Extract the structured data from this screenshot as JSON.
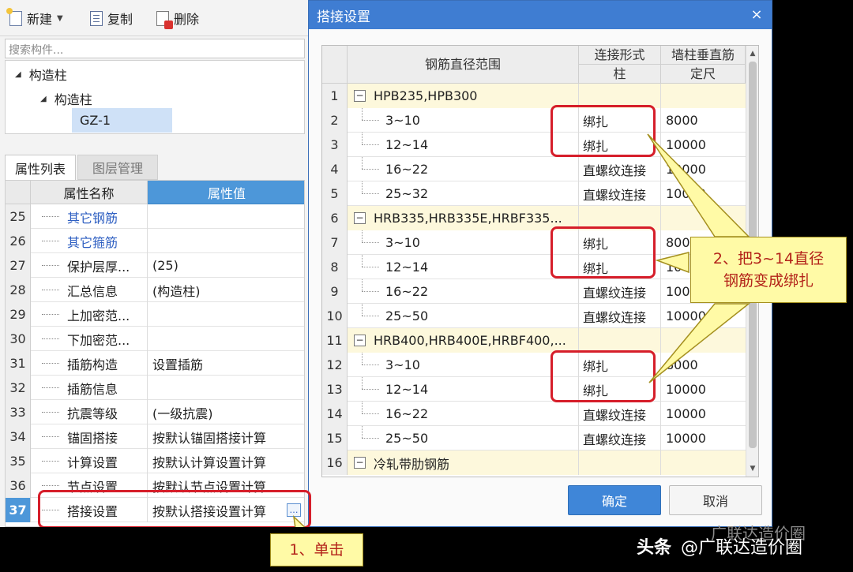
{
  "toolbar": {
    "new": "新建",
    "copy": "复制",
    "delete": "删除",
    "search_placeholder": "搜索构件..."
  },
  "tree": {
    "root": "构造柱",
    "child": "构造柱",
    "leaf": "GZ-1"
  },
  "tabs": {
    "props": "属性列表",
    "layers": "图层管理"
  },
  "props": {
    "col_name": "属性名称",
    "col_value": "属性值",
    "rows": [
      {
        "n": "25",
        "name": "其它钢筋",
        "value": ""
      },
      {
        "n": "26",
        "name": "其它箍筋",
        "value": ""
      },
      {
        "n": "27",
        "name": "保护层厚...",
        "value": "(25)"
      },
      {
        "n": "28",
        "name": "汇总信息",
        "value": "(构造柱)"
      },
      {
        "n": "29",
        "name": "上加密范...",
        "value": ""
      },
      {
        "n": "30",
        "name": "下加密范...",
        "value": ""
      },
      {
        "n": "31",
        "name": "插筋构造",
        "value": "设置插筋"
      },
      {
        "n": "32",
        "name": "插筋信息",
        "value": ""
      },
      {
        "n": "33",
        "name": "抗震等级",
        "value": "(一级抗震)"
      },
      {
        "n": "34",
        "name": "锚固搭接",
        "value": "按默认锚固搭接计算"
      },
      {
        "n": "35",
        "name": "计算设置",
        "value": "按默认计算设置计算"
      },
      {
        "n": "36",
        "name": "节点设置",
        "value": "按默认节点设置计算"
      },
      {
        "n": "37",
        "name": "搭接设置",
        "value": "按默认搭接设置计算"
      }
    ],
    "ellipsis": "…"
  },
  "dialog": {
    "title": "搭接设置",
    "close": "×",
    "col_range": "钢筋直径范围",
    "col_conn_top": "连接形式",
    "col_conn_sub": "柱",
    "col_len_top": "墙柱垂直筋",
    "col_len_sub": "定尺",
    "rows": [
      {
        "n": "1",
        "range": "HPB235,HPB300",
        "conn": "",
        "len": "",
        "group": true
      },
      {
        "n": "2",
        "range": "3~10",
        "conn": "绑扎",
        "len": "8000"
      },
      {
        "n": "3",
        "range": "12~14",
        "conn": "绑扎",
        "len": "10000"
      },
      {
        "n": "4",
        "range": "16~22",
        "conn": "直螺纹连接",
        "len": "10000"
      },
      {
        "n": "5",
        "range": "25~32",
        "conn": "直螺纹连接",
        "len": "10000"
      },
      {
        "n": "6",
        "range": "HRB335,HRB335E,HRBF335...",
        "conn": "",
        "len": "",
        "group": true
      },
      {
        "n": "7",
        "range": "3~10",
        "conn": "绑扎",
        "len": "8000"
      },
      {
        "n": "8",
        "range": "12~14",
        "conn": "绑扎",
        "len": "10000"
      },
      {
        "n": "9",
        "range": "16~22",
        "conn": "直螺纹连接",
        "len": "10000"
      },
      {
        "n": "10",
        "range": "25~50",
        "conn": "直螺纹连接",
        "len": "10000"
      },
      {
        "n": "11",
        "range": "HRB400,HRB400E,HRBF400,...",
        "conn": "",
        "len": "",
        "group": true
      },
      {
        "n": "12",
        "range": "3~10",
        "conn": "绑扎",
        "len": "8000"
      },
      {
        "n": "13",
        "range": "12~14",
        "conn": "绑扎",
        "len": "10000"
      },
      {
        "n": "14",
        "range": "16~22",
        "conn": "直螺纹连接",
        "len": "10000"
      },
      {
        "n": "15",
        "range": "25~50",
        "conn": "直螺纹连接",
        "len": "10000"
      },
      {
        "n": "16",
        "range": "冷轧带肋钢筋",
        "conn": "",
        "len": "",
        "group": true
      }
    ],
    "ok": "确定",
    "cancel": "取消"
  },
  "callouts": {
    "step1": "1、单击",
    "step2_line1": "2、把3~14直径",
    "step2_line2": "钢筋变成绑扎"
  },
  "watermark": {
    "brand": "头条",
    "account": "@广联达造价圈",
    "faded": "广联达造价圈"
  },
  "colors": {
    "accent": "#3f7dd2",
    "highlight": "#d61e2a",
    "callout_bg": "#fffaa6",
    "group_row": "#fdf8dc"
  }
}
